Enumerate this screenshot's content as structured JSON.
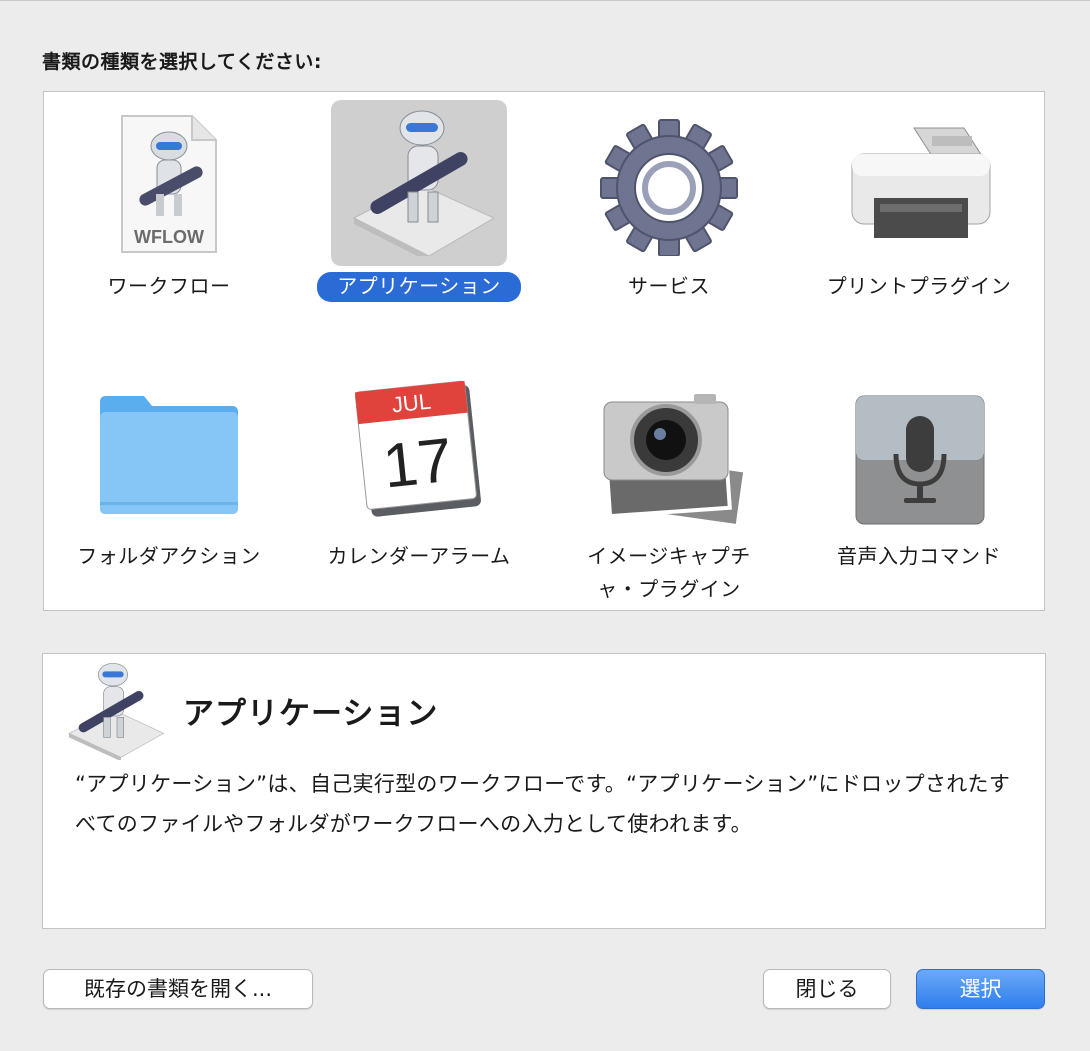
{
  "prompt": "書類の種類を選択してください:",
  "tiles": [
    {
      "label": "ワークフロー",
      "icon": "wflow-document-icon",
      "badge": "WFLOW"
    },
    {
      "label": "アプリケーション",
      "icon": "automator-robot-icon",
      "selected": true
    },
    {
      "label": "サービス",
      "icon": "gear-icon"
    },
    {
      "label": "プリントプラグイン",
      "icon": "printer-icon"
    },
    {
      "label": "フォルダアクション",
      "icon": "folder-icon"
    },
    {
      "label": "カレンダーアラーム",
      "icon": "calendar-icon",
      "month": "JUL",
      "day": "17"
    },
    {
      "label": "イメージキャプチャ・プラグイン",
      "icon": "camera-icon"
    },
    {
      "label": "音声入力コマンド",
      "icon": "microphone-icon"
    }
  ],
  "description": {
    "title": "アプリケーション",
    "text": "“アプリケーション”は、自己実行型のワークフローです。“アプリケーション”にドロップされたすべてのファイルやフォルダがワークフローへの入力として使われます。"
  },
  "buttons": {
    "open_existing": "既存の書類を開く...",
    "close": "閉じる",
    "choose": "選択"
  },
  "colors": {
    "selection": "#2a6bd6",
    "primary_button": "#3b86f0"
  }
}
